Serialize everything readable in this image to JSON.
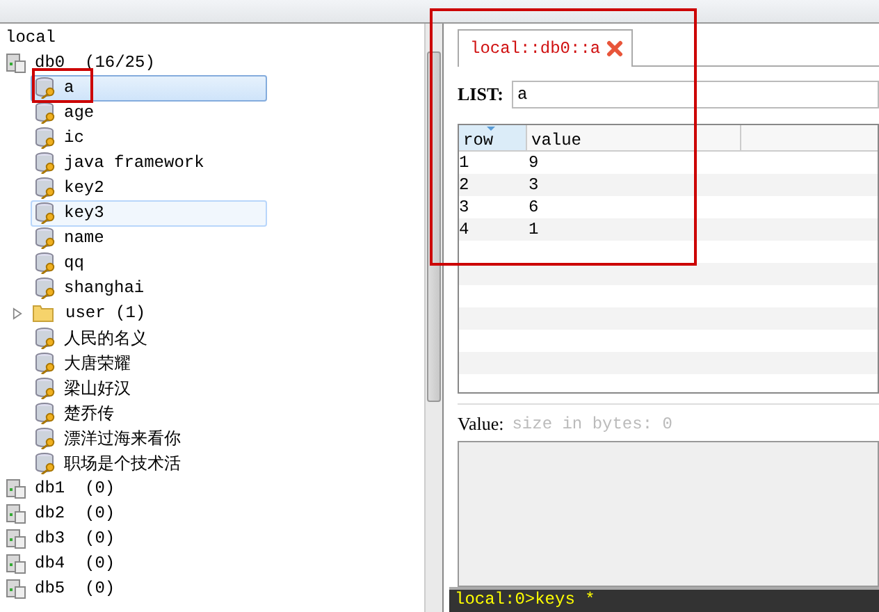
{
  "tree": {
    "root": "local",
    "databases": [
      {
        "name": "db0",
        "count": "(16/25)",
        "children": [
          {
            "kind": "key",
            "name": "a",
            "selected": true,
            "hovered": false
          },
          {
            "kind": "key",
            "name": "age",
            "selected": false,
            "hovered": false
          },
          {
            "kind": "key",
            "name": "ic",
            "selected": false,
            "hovered": false
          },
          {
            "kind": "key",
            "name": "java framework",
            "selected": false,
            "hovered": false
          },
          {
            "kind": "key",
            "name": "key2",
            "selected": false,
            "hovered": false
          },
          {
            "kind": "key",
            "name": "key3",
            "selected": false,
            "hovered": true
          },
          {
            "kind": "key",
            "name": "name",
            "selected": false,
            "hovered": false
          },
          {
            "kind": "key",
            "name": "qq",
            "selected": false,
            "hovered": false
          },
          {
            "kind": "key",
            "name": "shanghai",
            "selected": false,
            "hovered": false
          },
          {
            "kind": "folder",
            "name": "user",
            "count": "(1)",
            "expanded": false,
            "selected": false,
            "hovered": false
          },
          {
            "kind": "key",
            "name": "人民的名义",
            "selected": false,
            "hovered": false
          },
          {
            "kind": "key",
            "name": "大唐荣耀",
            "selected": false,
            "hovered": false
          },
          {
            "kind": "key",
            "name": "梁山好汉",
            "selected": false,
            "hovered": false
          },
          {
            "kind": "key",
            "name": "楚乔传",
            "selected": false,
            "hovered": false
          },
          {
            "kind": "key",
            "name": "漂洋过海来看你",
            "selected": false,
            "hovered": false
          },
          {
            "kind": "key",
            "name": "职场是个技术活",
            "selected": false,
            "hovered": false
          }
        ]
      },
      {
        "name": "db1",
        "count": "(0)"
      },
      {
        "name": "db2",
        "count": "(0)"
      },
      {
        "name": "db3",
        "count": "(0)"
      },
      {
        "name": "db4",
        "count": "(0)"
      },
      {
        "name": "db5",
        "count": "(0)"
      }
    ]
  },
  "tab": {
    "label": "local::db0::a",
    "selected": true
  },
  "list": {
    "label": "LIST:",
    "key": "a"
  },
  "table": {
    "columns": [
      "row",
      "value"
    ],
    "rows": [
      [
        "1",
        "9"
      ],
      [
        "2",
        "3"
      ],
      [
        "3",
        "6"
      ],
      [
        "4",
        "1"
      ]
    ]
  },
  "value": {
    "label": "Value:",
    "hint": "size in bytes: 0"
  },
  "console": {
    "line": "local:0>keys *"
  }
}
